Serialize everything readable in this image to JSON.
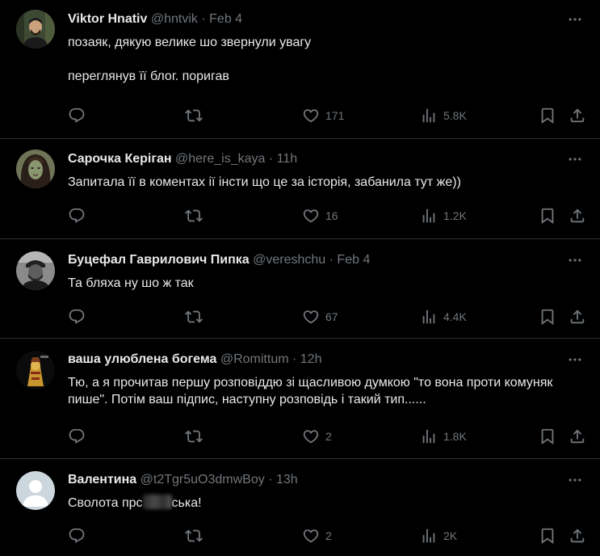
{
  "tweets": [
    {
      "name": "Viktor Hnativ",
      "handle": "@hntvik",
      "dot": "·",
      "time": "Feb 4",
      "text": "позаяк, дякую велике шо звернули увагу\n\nпереглянув її блог. поригав",
      "likes": "171",
      "views": "5.8K",
      "avatar": "photo-man-forest"
    },
    {
      "name": "Сарочка Керіган",
      "handle": "@here_is_kaya",
      "dot": "·",
      "time": "11h",
      "text": "Запитала її в коментах ії інсти що це за історія, забанила тут же))",
      "likes": "16",
      "views": "1.2K",
      "avatar": "portrait-woman-dark-hair"
    },
    {
      "name": "Буцефал Гаврилович Пипка",
      "handle": "@vereshchu",
      "dot": "·",
      "time": "Feb 4",
      "text": "Та бляха ну шо ж так",
      "likes": "67",
      "views": "4.4K",
      "avatar": "bw-photo-man-cap"
    },
    {
      "name": "ваша улюблена богема",
      "handle": "@Romittum",
      "dot": "·",
      "time": "12h",
      "text": "Тю, а я прочитав першу розповіддю зі щасливою думкою \"то вона проти комуняк пише\". Потім ваш підпис, наступну розповідь і такий тип......",
      "likes": "2",
      "views": "1.8K",
      "avatar": "artwork-gold-figure"
    },
    {
      "name": "Валентина",
      "handle": "@t2Tgr5uO3dmwBoy",
      "dot": "·",
      "time": "13h",
      "text_before": "Сволота прс",
      "text_after": "ська!",
      "likes": "2",
      "views": "2K",
      "avatar": "default-avatar"
    }
  ],
  "colors": {
    "background": "#000000",
    "text": "#e7e9ea",
    "muted": "#71767b",
    "divider": "#2f3336"
  },
  "icons": [
    "reply-icon",
    "retweet-icon",
    "like-icon",
    "views-icon",
    "bookmark-icon",
    "share-icon",
    "more-icon"
  ]
}
